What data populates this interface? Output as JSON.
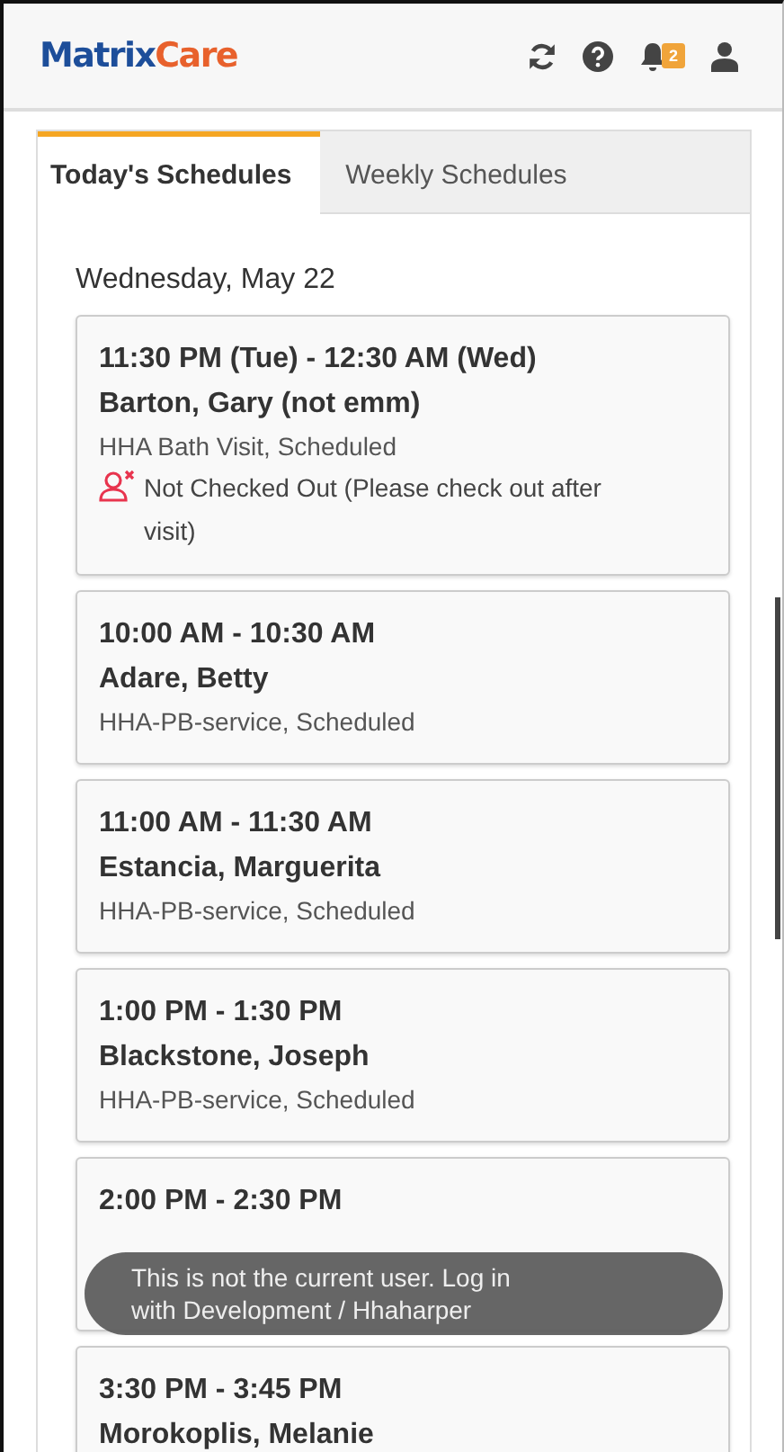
{
  "header": {
    "logo": {
      "part_1": "Matrix",
      "part_2": "Care"
    },
    "notification_count": "2"
  },
  "tabs": [
    {
      "label": "Today's Schedules",
      "selected": true
    },
    {
      "label": "Weekly Schedules",
      "selected": false
    }
  ],
  "date_heading": "Wednesday, May 22",
  "schedules": [
    {
      "time": "11:30 PM (Tue) - 12:30 AM (Wed)",
      "client": "Barton, Gary (not emm)",
      "service": "HHA Bath Visit, Scheduled",
      "alert": "Not Checked Out (Please check out after visit)"
    },
    {
      "time": "10:00 AM - 10:30 AM",
      "client": "Adare, Betty",
      "service": "HHA-PB-service, Scheduled"
    },
    {
      "time": "11:00 AM - 11:30 AM",
      "client": "Estancia, Marguerita",
      "service": "HHA-PB-service, Scheduled"
    },
    {
      "time": "1:00 PM - 1:30 PM",
      "client": "Blackstone, Joseph",
      "service": "HHA-PB-service, Scheduled"
    },
    {
      "time": "2:00 PM - 2:30 PM"
    },
    {
      "time": "3:30 PM - 3:45 PM",
      "client": "Morokoplis, Melanie"
    }
  ],
  "toast": "This is not the current user.  Log in with Development / Hhaharper"
}
